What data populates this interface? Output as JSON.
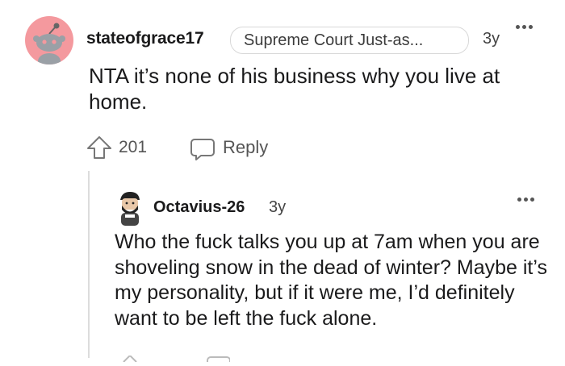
{
  "comment": {
    "username": "stateofgrace17",
    "flair": "Supreme Court Just-as...",
    "age": "3y",
    "body": "NTA it’s none of his business why you live at home.",
    "score": "201",
    "reply_label": "Reply"
  },
  "reply": {
    "username": "Octavius-26",
    "age": "3y",
    "body": "Who the fuck talks you up at 7am when you are shoveling snow in the dead of winter? Maybe it’s my personality, but if it were me, I’d definitely want to be left the fuck alone."
  },
  "colors": {
    "avatar_bg": "#f4999e",
    "text": "#1a1a1b",
    "muted": "#555555",
    "thread_line": "#dcdcdc"
  },
  "icons": [
    "snoo-avatar-icon",
    "more-options-icon",
    "upvote-icon",
    "reply-icon",
    "custom-avatar-icon"
  ]
}
